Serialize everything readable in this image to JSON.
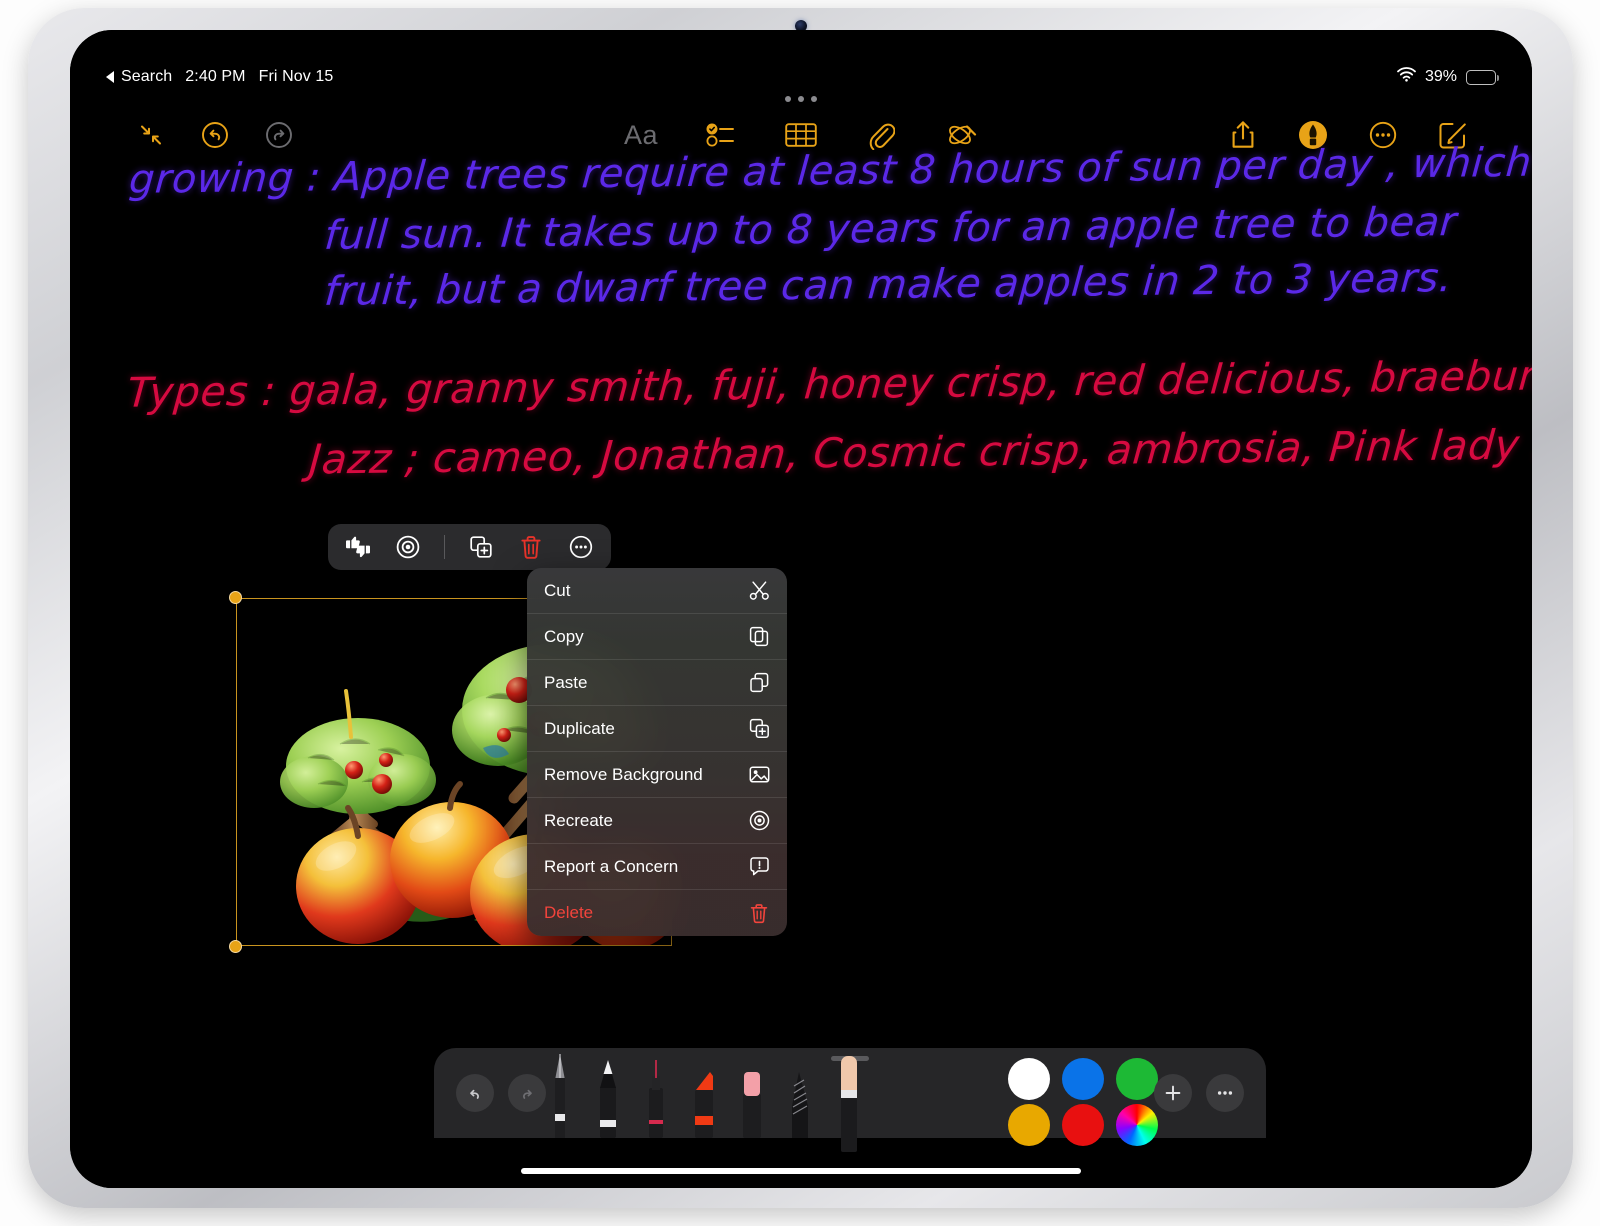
{
  "status_bar": {
    "back_label": "Search",
    "time": "2:40 PM",
    "date": "Fri Nov 15",
    "battery_percent": "39%",
    "wifi_icon": "wifi-icon",
    "battery_icon": "battery-icon"
  },
  "toolbar": {
    "left": [
      {
        "name": "collapse-button",
        "icon": "collapse-arrows-icon",
        "state": "enabled"
      },
      {
        "name": "undo-button",
        "icon": "undo-icon",
        "state": "enabled"
      },
      {
        "name": "redo-button",
        "icon": "redo-icon",
        "state": "disabled"
      }
    ],
    "center": [
      {
        "name": "text-format-button",
        "icon": "aa-text-icon",
        "label": "Aa",
        "state": "disabled"
      },
      {
        "name": "checklist-button",
        "icon": "checklist-icon",
        "state": "enabled"
      },
      {
        "name": "table-button",
        "icon": "table-icon",
        "state": "enabled"
      },
      {
        "name": "attachment-button",
        "icon": "paperclip-icon",
        "state": "enabled"
      },
      {
        "name": "image-wand-button",
        "icon": "image-playground-icon",
        "state": "enabled"
      }
    ],
    "right": [
      {
        "name": "share-button",
        "icon": "share-icon"
      },
      {
        "name": "markup-button",
        "icon": "pen-markup-icon",
        "state": "active"
      },
      {
        "name": "more-button",
        "icon": "ellipsis-circle-icon"
      },
      {
        "name": "compose-button",
        "icon": "compose-icon"
      }
    ]
  },
  "note": {
    "purple_lines": [
      "growing :   Apple  trees  require  at  least  8  hours  of  sun  per day ,  which  is",
      "full  sun.  It  takes  up  to  8  years  for  an  apple  tree  to  bear",
      "fruit,  but  a  dwarf  tree  can  make  apples  in  2 to 3  years."
    ],
    "red_lines": [
      "Types  :  gala,  granny  smith,  fuji,  honey  crisp,  red  delicious,  braebum",
      "Jazz ; cameo, Jonathan,  Cosmic  crisp,  ambrosia,  Pink  lady  ."
    ],
    "purple_ink_color": "#5B28E8",
    "red_ink_color": "#D60A40"
  },
  "image_actions": [
    {
      "name": "feedback-button",
      "icon": "thumbs-up-down-icon"
    },
    {
      "name": "recreate-button",
      "icon": "target-circle-icon"
    },
    {
      "name": "duplicate-button",
      "icon": "duplicate-icon"
    },
    {
      "name": "delete-button",
      "icon": "trash-icon",
      "color": "#E8332A"
    },
    {
      "name": "more-options-button",
      "icon": "ellipsis-circle-icon"
    }
  ],
  "context_menu": {
    "items": [
      {
        "label": "Cut",
        "icon": "scissors-icon",
        "danger": false
      },
      {
        "label": "Copy",
        "icon": "copy-icon",
        "danger": false
      },
      {
        "label": "Paste",
        "icon": "paste-icon",
        "danger": false
      },
      {
        "label": "Duplicate",
        "icon": "duplicate-icon",
        "danger": false
      },
      {
        "label": "Remove Background",
        "icon": "photo-icon",
        "danger": false
      },
      {
        "label": "Recreate",
        "icon": "target-circle-icon",
        "danger": false
      },
      {
        "label": "Report a Concern",
        "icon": "exclamation-bubble-icon",
        "danger": false
      },
      {
        "label": "Delete",
        "icon": "trash-icon",
        "danger": true
      }
    ],
    "danger_color": "#F2443C"
  },
  "selected_image": {
    "name": "apple-trees-illustration",
    "selected": true,
    "handle_color": "#E8A317"
  },
  "pen_palette": {
    "undo_icon": "undo-icon",
    "redo_icon": "redo-icon",
    "tools": [
      {
        "name": "fountain-pen-tool",
        "selected": false
      },
      {
        "name": "pencil-tool",
        "selected": false
      },
      {
        "name": "pen-tool",
        "selected": false
      },
      {
        "name": "highlighter-tool",
        "selected": false
      },
      {
        "name": "marker-tool",
        "selected": false
      },
      {
        "name": "shading-tool",
        "selected": false
      },
      {
        "name": "crayon-tool",
        "selected": true
      }
    ],
    "colors": [
      {
        "name": "white",
        "hex": "#FFFFFF"
      },
      {
        "name": "blue",
        "hex": "#0A73E8"
      },
      {
        "name": "green",
        "hex": "#1DB935"
      },
      {
        "name": "gold",
        "hex": "#E8A800"
      },
      {
        "name": "red",
        "hex": "#E81010"
      },
      {
        "name": "color-picker",
        "hex": "rainbow"
      }
    ],
    "add_button_icon": "plus-icon",
    "more_button_icon": "ellipsis-icon"
  }
}
